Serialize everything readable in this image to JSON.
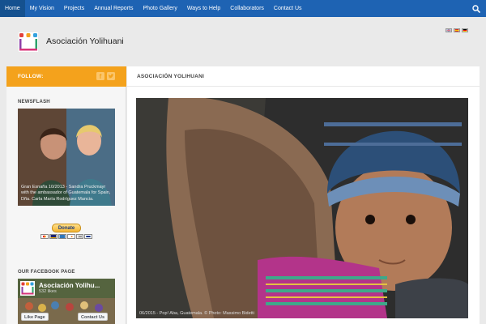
{
  "nav": {
    "items": [
      {
        "label": "Home"
      },
      {
        "label": "My Vision"
      },
      {
        "label": "Projects"
      },
      {
        "label": "Annual Reports"
      },
      {
        "label": "Photo Gallery"
      },
      {
        "label": "Ways to Help"
      },
      {
        "label": "Collaborators"
      },
      {
        "label": "Contact Us"
      }
    ],
    "active_index": 0,
    "search_icon": "search-icon"
  },
  "header": {
    "site_title": "Asociación Yolihuani",
    "languages": [
      "English",
      "Español",
      "Deutsch"
    ]
  },
  "sidebar": {
    "follow_label": "FOLLOW:",
    "social_icons": [
      "facebook-icon",
      "twitter-icon"
    ],
    "newsflash_title": "NEWSFLASH",
    "newsflash_caption": "Gran Esnaña 10/2013 - Sandra Pruckmayr with the ambassador of Guatemala for Spain, Dña. Carla María Rodríguez Mancia.",
    "donate_label": "Donate",
    "facebook_title": "OUR FACEBOOK PAGE",
    "facebook_name": "Asociación Yolihu...",
    "facebook_likes": "532 likes",
    "like_label": "Like Page",
    "contact_label": "Contact Us"
  },
  "main": {
    "title": "ASOCIACIÓN YOLIHUANI",
    "hero_caption": "06/2015 - Pop! Aba, Guatemala. © Photo: Massimo Bidetti"
  },
  "colors": {
    "nav_bg": "#1e63b3",
    "follow_bg": "#f4a21c",
    "page_bg": "#eaeaea"
  }
}
